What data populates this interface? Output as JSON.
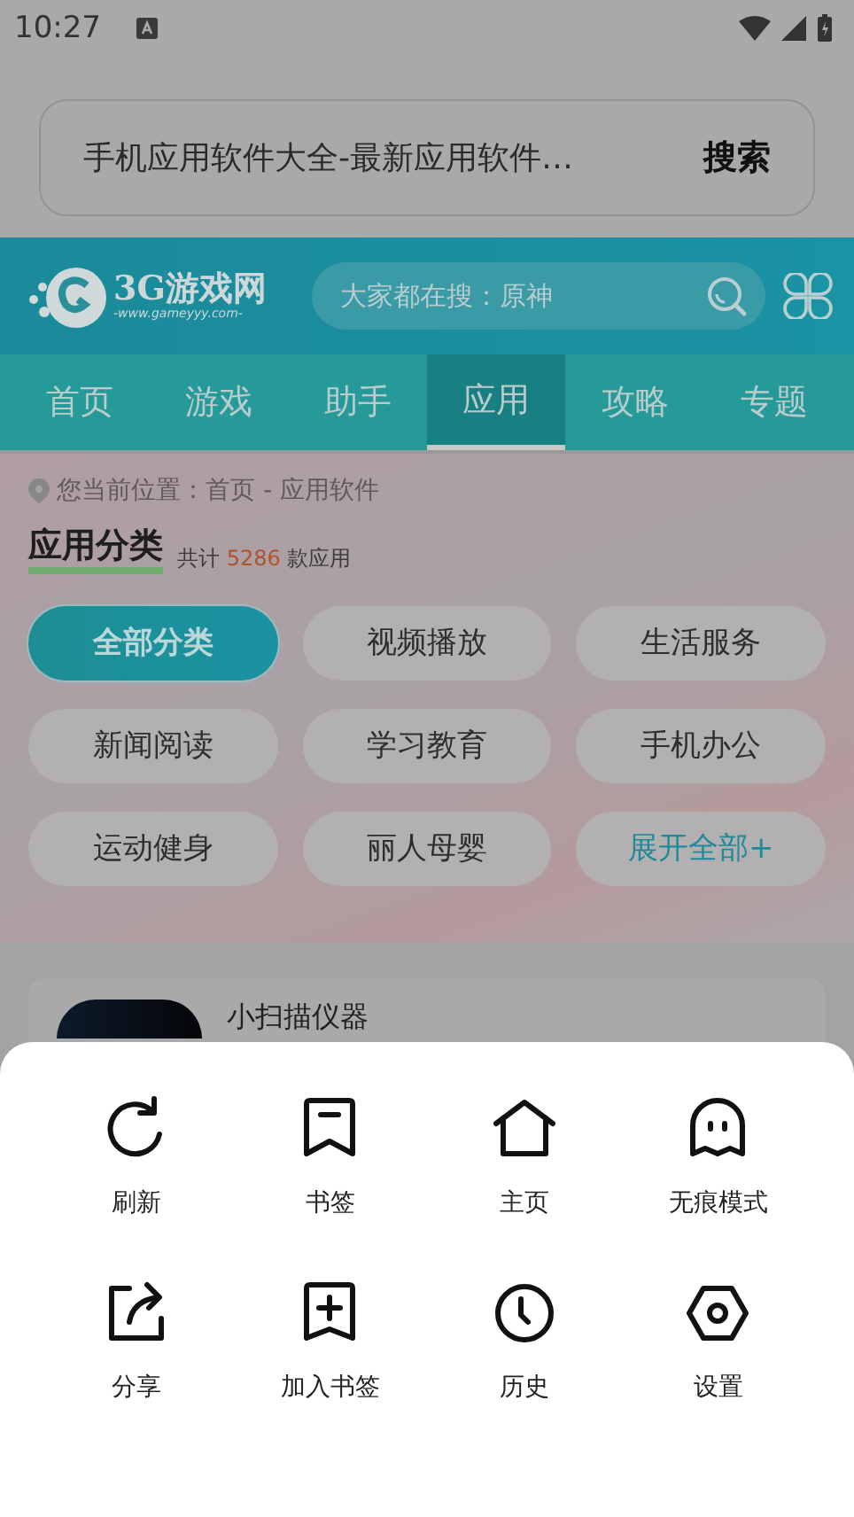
{
  "status_bar": {
    "time": "10:27"
  },
  "url_bar": {
    "text": "手机应用软件大全-最新应用软件…",
    "button": "搜索"
  },
  "site_header": {
    "logo": "3G游戏网",
    "logo_domain": "-www.gameyyy.com-",
    "search": {
      "placeholder": "大家都在搜：原神"
    }
  },
  "nav_tabs": [
    {
      "label": "首页",
      "selected": false
    },
    {
      "label": "游戏",
      "selected": false
    },
    {
      "label": "助手",
      "selected": false
    },
    {
      "label": "应用",
      "selected": true
    },
    {
      "label": "攻略",
      "selected": false
    },
    {
      "label": "专题",
      "selected": false
    }
  ],
  "breadcrumb": "您当前位置：首页 - 应用软件",
  "section": {
    "title": "应用分类",
    "count_prefix": "共计",
    "count": "5286",
    "count_suffix": "款应用"
  },
  "categories": [
    {
      "label": "全部分类",
      "kind": "category",
      "selected": true
    },
    {
      "label": "视频播放",
      "kind": "category",
      "selected": false
    },
    {
      "label": "生活服务",
      "kind": "category",
      "selected": false
    },
    {
      "label": "新闻阅读",
      "kind": "category",
      "selected": false
    },
    {
      "label": "学习教育",
      "kind": "category",
      "selected": false
    },
    {
      "label": "手机办公",
      "kind": "category",
      "selected": false
    },
    {
      "label": "运动健身",
      "kind": "category",
      "selected": false
    },
    {
      "label": "丽人母婴",
      "kind": "category",
      "selected": false
    },
    {
      "label": "展开全部+",
      "kind": "expand",
      "selected": false
    }
  ],
  "app_card": {
    "title": "小扫描仪器"
  },
  "menu": [
    {
      "label": "刷新"
    },
    {
      "label": "书签"
    },
    {
      "label": "主页"
    },
    {
      "label": "无痕模式"
    },
    {
      "label": "分享"
    },
    {
      "label": "加入书签"
    },
    {
      "label": "历史"
    },
    {
      "label": "设置"
    }
  ]
}
